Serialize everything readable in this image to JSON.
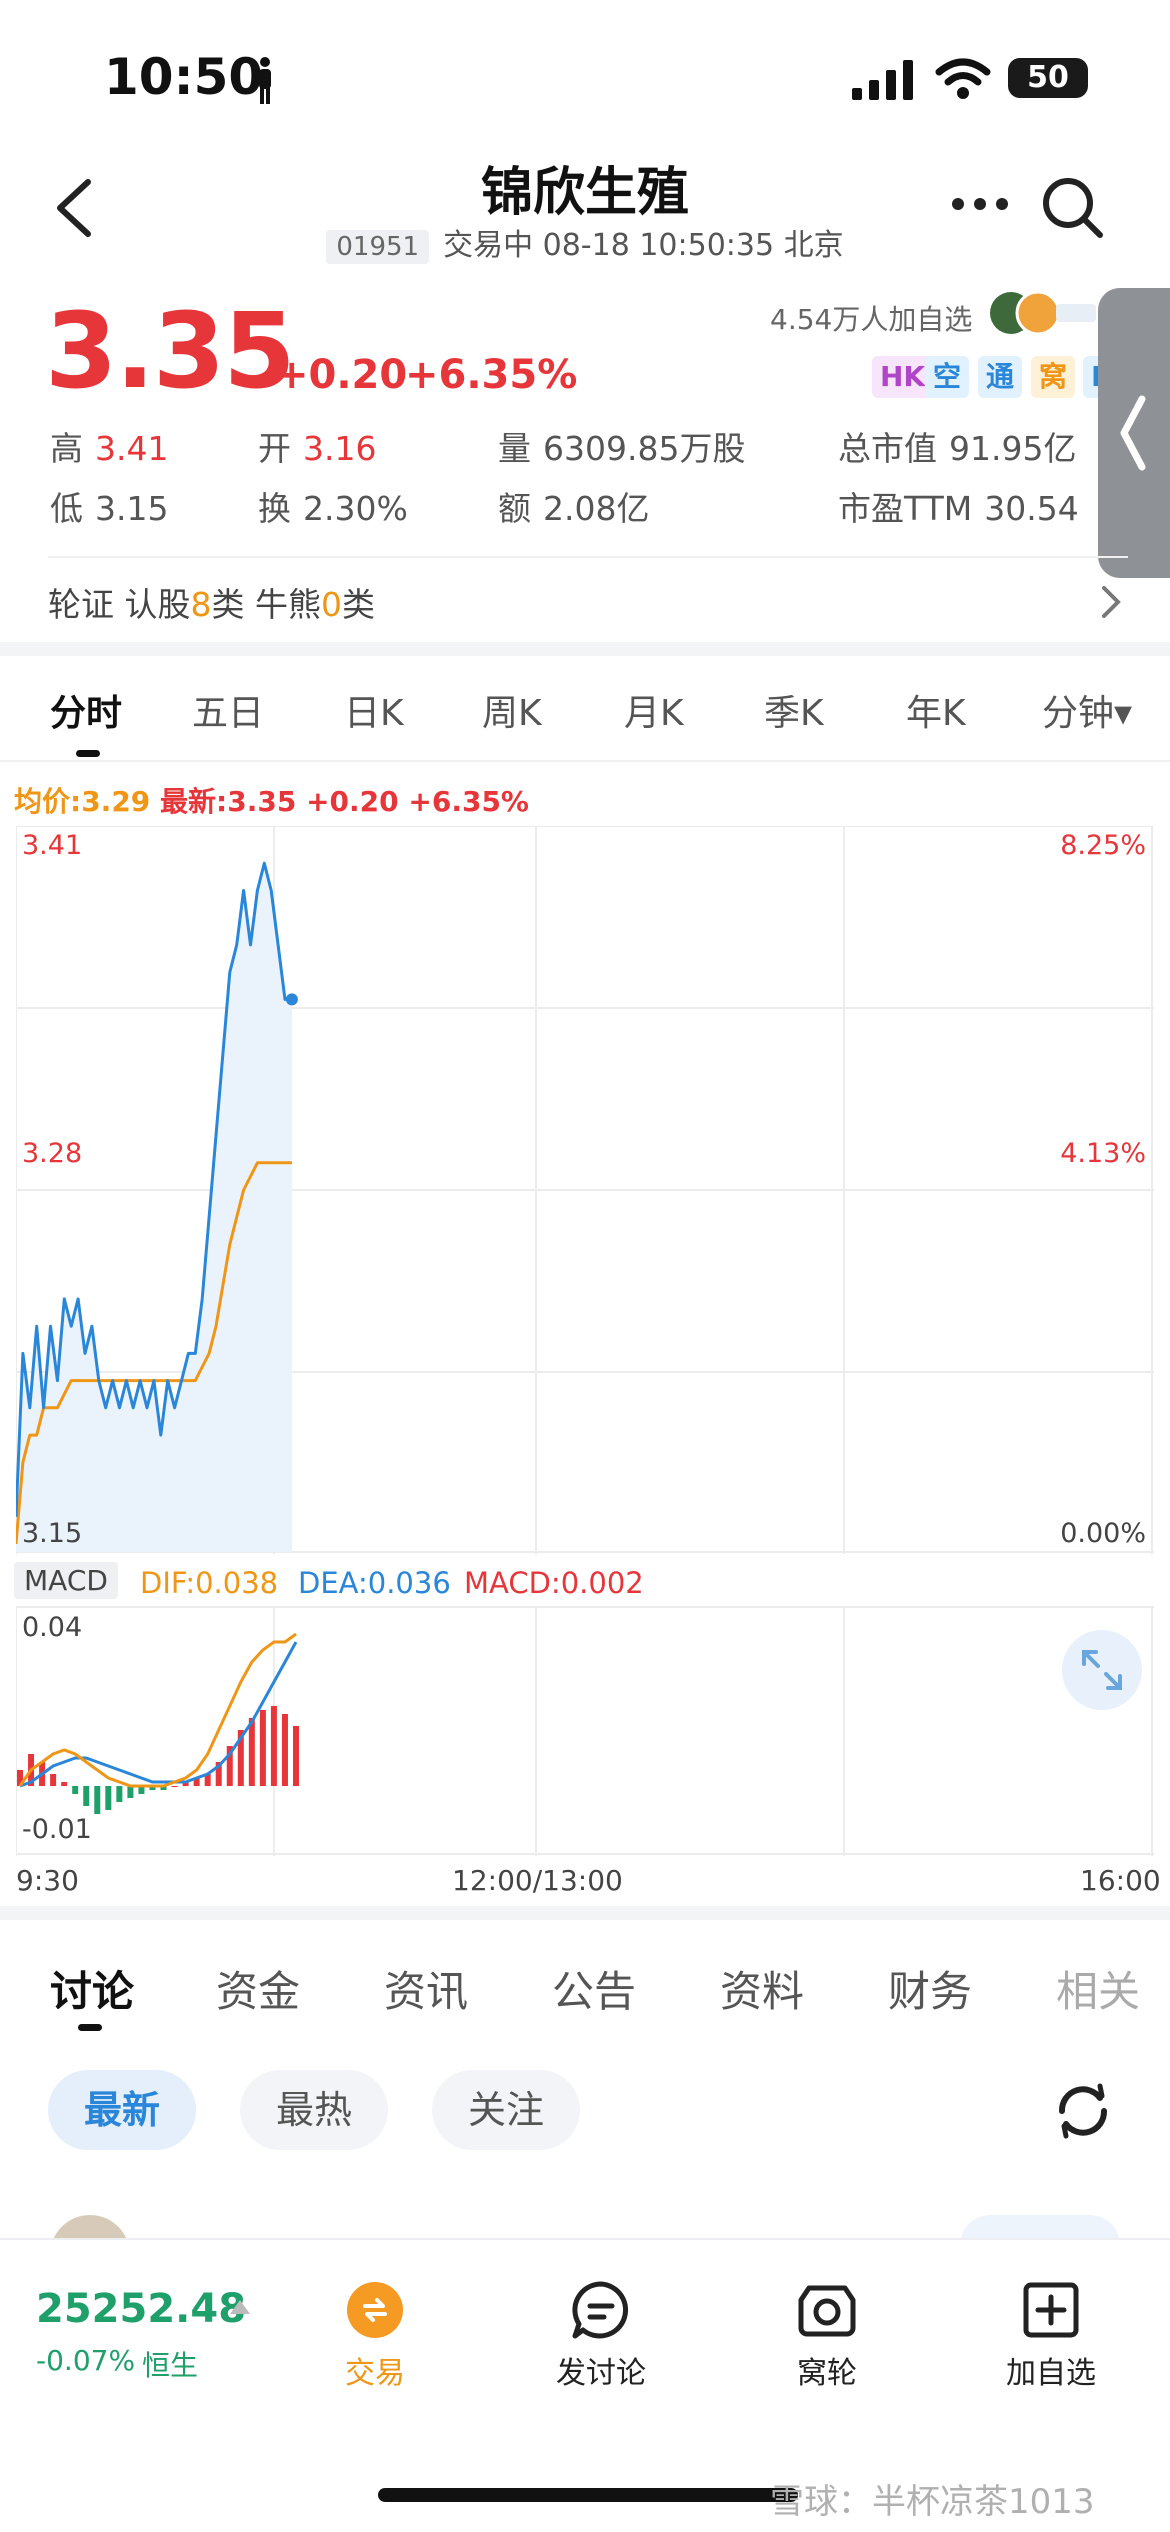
{
  "status_bar": {
    "time": "10:50",
    "battery": "50"
  },
  "header": {
    "title": "锦欣生殖",
    "code": "01951",
    "status_line": "交易中 08-18 10:50:35 北京"
  },
  "quote": {
    "price": "3.35",
    "change": "+0.20",
    "change_pct": "+6.35%",
    "followers": "4.54万人加自选",
    "tags": [
      "HK",
      "空",
      "通",
      "窝",
      "L"
    ],
    "stats": {
      "high_label": "高",
      "high_value": "3.41",
      "open_label": "开",
      "open_value": "3.16",
      "volume_label": "量",
      "volume_value": "6309.85万股",
      "mcap_label": "总市值",
      "mcap_value": "91.95亿",
      "low_label": "低",
      "low_value": "3.15",
      "turnover_label": "换",
      "turnover_value": "2.30%",
      "amount_label": "额",
      "amount_value": "2.08亿",
      "pe_label": "市盈TTM",
      "pe_value": "30.54"
    }
  },
  "warrants": {
    "prefix": "轮证",
    "call_label": "认股",
    "call_count": "8",
    "call_unit": "类",
    "bull_label": "牛熊",
    "bull_count": "0",
    "bull_unit": "类"
  },
  "period_tabs": [
    "分时",
    "五日",
    "日K",
    "周K",
    "月K",
    "季K",
    "年K",
    "分钟▾"
  ],
  "chart_header": {
    "avg": "均价:3.29",
    "latest": "最新:3.35",
    "change": "+0.20",
    "pct": "+6.35%"
  },
  "macd_header": {
    "label": "MACD",
    "dif": "DIF:0.038",
    "dea": "DEA:0.036",
    "macd": "MACD:0.002"
  },
  "colors": {
    "up": "#e6363a",
    "down": "#1fa06b",
    "price_line": "#2a86d8",
    "avg_line": "#f09616",
    "accent": "#2a86d8"
  },
  "chart_data": [
    {
      "type": "line",
      "title": "",
      "x_ticks": [
        "9:30",
        "12:00/13:00",
        "16:00"
      ],
      "ylim": [
        3.15,
        3.41
      ],
      "y_ticks_left": [
        "3.41",
        "3.28",
        "3.15"
      ],
      "y_ticks_right": [
        "8.25%",
        "4.13%",
        "0.00%"
      ],
      "x_minutes": [
        0,
        2,
        4,
        6,
        8,
        10,
        12,
        14,
        16,
        18,
        20,
        22,
        24,
        26,
        28,
        30,
        32,
        34,
        36,
        38,
        40,
        42,
        44,
        46,
        48,
        50,
        52,
        54,
        56,
        58,
        60,
        62,
        64,
        66,
        68,
        70,
        72,
        74,
        76,
        78,
        80
      ],
      "series": [
        {
          "values": [
            3.16,
            3.22,
            3.2,
            3.23,
            3.2,
            3.23,
            3.21,
            3.24,
            3.23,
            3.24,
            3.22,
            3.23,
            3.21,
            3.2,
            3.21,
            3.2,
            3.21,
            3.2,
            3.21,
            3.2,
            3.21,
            3.19,
            3.21,
            3.2,
            3.21,
            3.22,
            3.22,
            3.24,
            3.27,
            3.3,
            3.33,
            3.36,
            3.37,
            3.39,
            3.37,
            3.39,
            3.4,
            3.39,
            3.37,
            3.35,
            3.35
          ]
        },
        {
          "values": [
            3.15,
            3.18,
            3.19,
            3.19,
            3.2,
            3.2,
            3.2,
            3.205,
            3.21,
            3.21,
            3.21,
            3.21,
            3.21,
            3.21,
            3.21,
            3.21,
            3.21,
            3.21,
            3.21,
            3.21,
            3.21,
            3.21,
            3.21,
            3.21,
            3.21,
            3.21,
            3.21,
            3.215,
            3.22,
            3.23,
            3.245,
            3.26,
            3.27,
            3.28,
            3.285,
            3.29,
            3.29,
            3.29,
            3.29,
            3.29,
            3.29
          ]
        }
      ]
    },
    {
      "type": "bar",
      "title": "",
      "ylim": [
        -0.01,
        0.04
      ],
      "y_ticks": [
        "0.04",
        "-0.01"
      ],
      "macd_bars": [
        0.004,
        0.008,
        0.006,
        0.003,
        0.001,
        -0.002,
        -0.005,
        -0.007,
        -0.006,
        -0.004,
        -0.003,
        -0.002,
        -0.001,
        -0.001,
        0.0,
        0.001,
        0.002,
        0.003,
        0.006,
        0.01,
        0.014,
        0.017,
        0.019,
        0.02,
        0.018,
        0.015
      ],
      "dif": [
        0.0,
        0.004,
        0.006,
        0.008,
        0.009,
        0.008,
        0.006,
        0.004,
        0.002,
        0.001,
        0.0,
        0.0,
        0.0,
        0.0,
        0.001,
        0.002,
        0.004,
        0.008,
        0.014,
        0.02,
        0.026,
        0.031,
        0.034,
        0.036,
        0.036,
        0.038
      ],
      "dea": [
        0.0,
        0.001,
        0.003,
        0.005,
        0.006,
        0.007,
        0.007,
        0.006,
        0.005,
        0.004,
        0.003,
        0.002,
        0.001,
        0.001,
        0.001,
        0.001,
        0.002,
        0.003,
        0.005,
        0.008,
        0.012,
        0.016,
        0.021,
        0.026,
        0.031,
        0.036
      ]
    }
  ],
  "discussion": {
    "tabs": [
      "讨论",
      "资金",
      "资讯",
      "公告",
      "资料",
      "财务",
      "相关"
    ],
    "filters": [
      "最新",
      "最热",
      "关注"
    ]
  },
  "bottom_bar": {
    "index_value": "25252.48",
    "index_change": "-0.07%",
    "index_name": "恒生",
    "buttons": [
      "交易",
      "发讨论",
      "窝轮",
      "加自选"
    ]
  },
  "watermark": "雪球：半杯凉茶1013"
}
